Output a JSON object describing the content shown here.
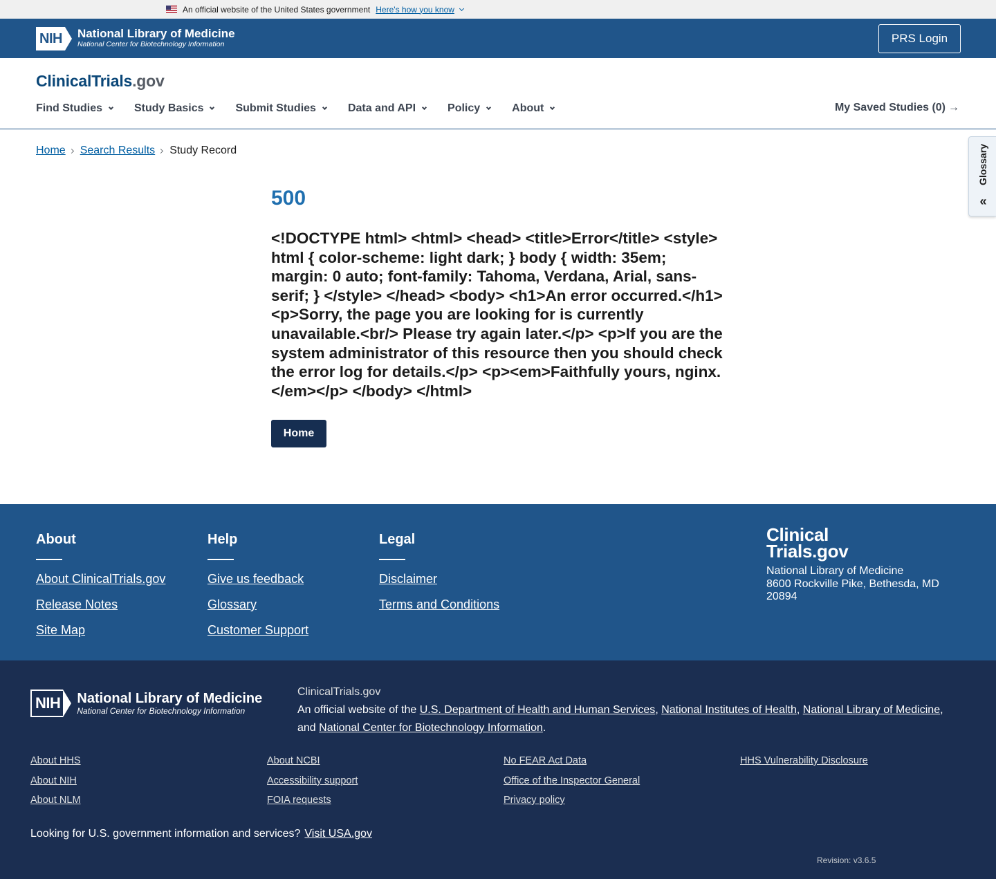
{
  "gov_banner": {
    "text": "An official website of the United States government",
    "link": "Here's how you know"
  },
  "nlm_header": {
    "nih": "NIH",
    "title": "National Library of Medicine",
    "subtitle": "National Center for Biotechnology Information",
    "login": "PRS Login"
  },
  "site_header": {
    "logo_main": "ClinicalTrials",
    "logo_suffix": ".gov",
    "nav": [
      "Find Studies",
      "Study Basics",
      "Submit Studies",
      "Data and API",
      "Policy",
      "About"
    ],
    "saved": "My Saved Studies (0)",
    "saved_arrow": "→"
  },
  "glossary": {
    "label": "Glossary",
    "icon": "«"
  },
  "breadcrumb": {
    "home": "Home",
    "search": "Search Results",
    "current": "Study Record"
  },
  "main": {
    "code": "500",
    "message": "<!DOCTYPE html> <html> <head> <title>Error</title> <style> html { color-scheme: light dark; } body { width: 35em; margin: 0 auto; font-family: Tahoma, Verdana, Arial, sans-serif; } </style> </head> <body> <h1>An error occurred.</h1> <p>Sorry, the page you are looking for is currently unavailable.<br/> Please try again later.</p> <p>If you are the system administrator of this resource then you should check the error log for details.</p> <p><em>Faithfully yours, nginx.</em></p> </body> </html>",
    "home_button": "Home"
  },
  "footer_top": {
    "about": {
      "heading": "About",
      "links": [
        "About ClinicalTrials.gov",
        "Release Notes",
        "Site Map"
      ]
    },
    "help": {
      "heading": "Help",
      "links": [
        "Give us feedback",
        "Glossary",
        "Customer Support"
      ]
    },
    "legal": {
      "heading": "Legal",
      "links": [
        "Disclaimer",
        "Terms and Conditions"
      ]
    },
    "brand": {
      "line1": "Clinical",
      "line2": "Trials.gov",
      "address1": "National Library of Medicine",
      "address2": "8600 Rockville Pike, Bethesda, MD 20894"
    }
  },
  "footer_bottom": {
    "nih": "NIH",
    "title": "National Library of Medicine",
    "subtitle": "National Center for Biotechnology Information",
    "site": "ClinicalTrials.gov",
    "official_prefix": "An official website of the",
    "hhs": "U.S. Department of Health and Human Services",
    "nih_link": "National Institutes of Health",
    "nlm_link": "National Library of Medicine",
    "and": "and",
    "ncbi_link": "National Center for Biotechnology Information",
    "col1": [
      "About HHS",
      "About NIH",
      "About NLM"
    ],
    "col2": [
      "About NCBI",
      "Accessibility support",
      "FOIA requests"
    ],
    "col3": [
      "No FEAR Act Data",
      "Office of the Inspector General",
      "Privacy policy"
    ],
    "col4": [
      "HHS Vulnerability Disclosure"
    ],
    "usa_text": "Looking for U.S. government information and services?",
    "usa_link": "Visit USA.gov",
    "revision": "Revision: v3.6.5"
  }
}
